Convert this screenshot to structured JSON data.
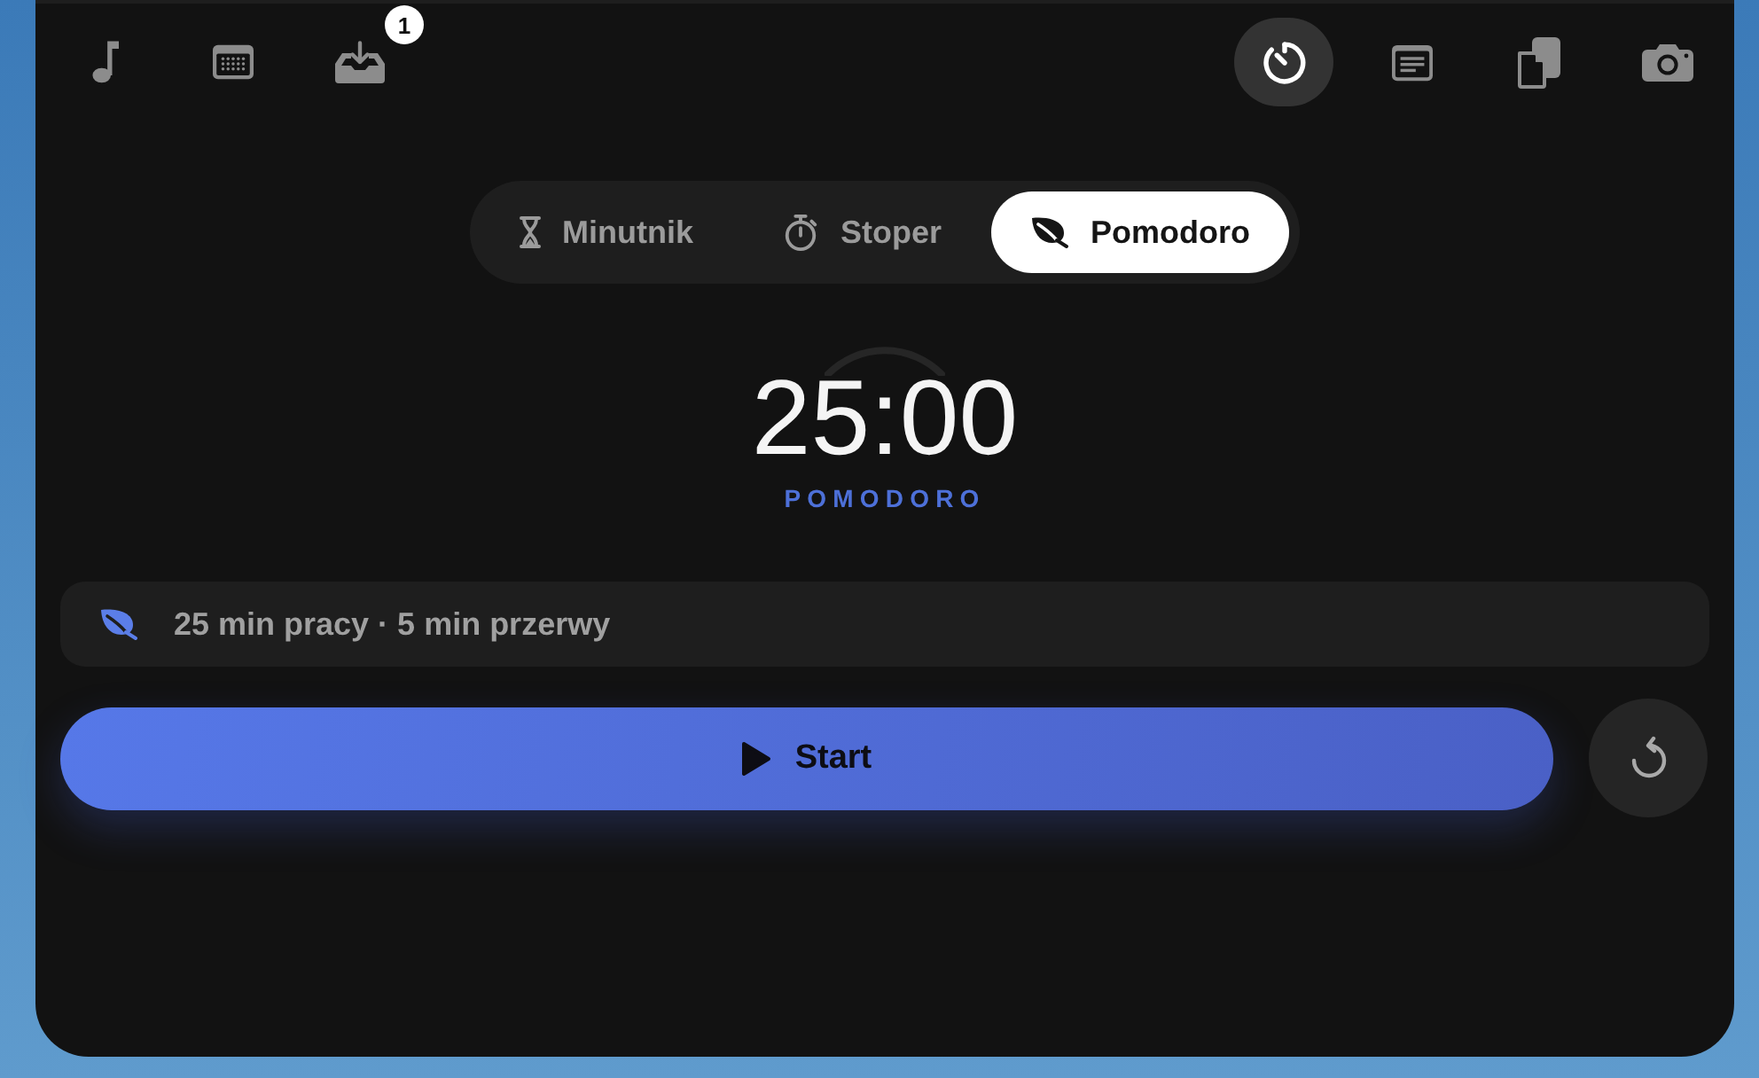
{
  "toolbar": {
    "left": [
      {
        "kind": "music",
        "selected": false
      },
      {
        "kind": "calendar",
        "selected": false
      },
      {
        "kind": "inbox",
        "selected": false,
        "badge": "1"
      }
    ],
    "right": [
      {
        "kind": "timer",
        "selected": true
      },
      {
        "kind": "notes",
        "selected": false
      },
      {
        "kind": "files",
        "selected": false
      },
      {
        "kind": "camera",
        "selected": false
      }
    ]
  },
  "mode_tabs": [
    {
      "label": "Minutnik",
      "kind": "hourglass",
      "selected": false
    },
    {
      "label": "Stoper",
      "kind": "stopwatch",
      "selected": false
    },
    {
      "label": "Pomodoro",
      "kind": "leaf",
      "selected": true
    }
  ],
  "timer": {
    "time": "25:00",
    "mode_label": "POMODORO"
  },
  "session_info": {
    "text": "25 min pracy · 5 min przerwy"
  },
  "start_button": {
    "label": "Start"
  }
}
